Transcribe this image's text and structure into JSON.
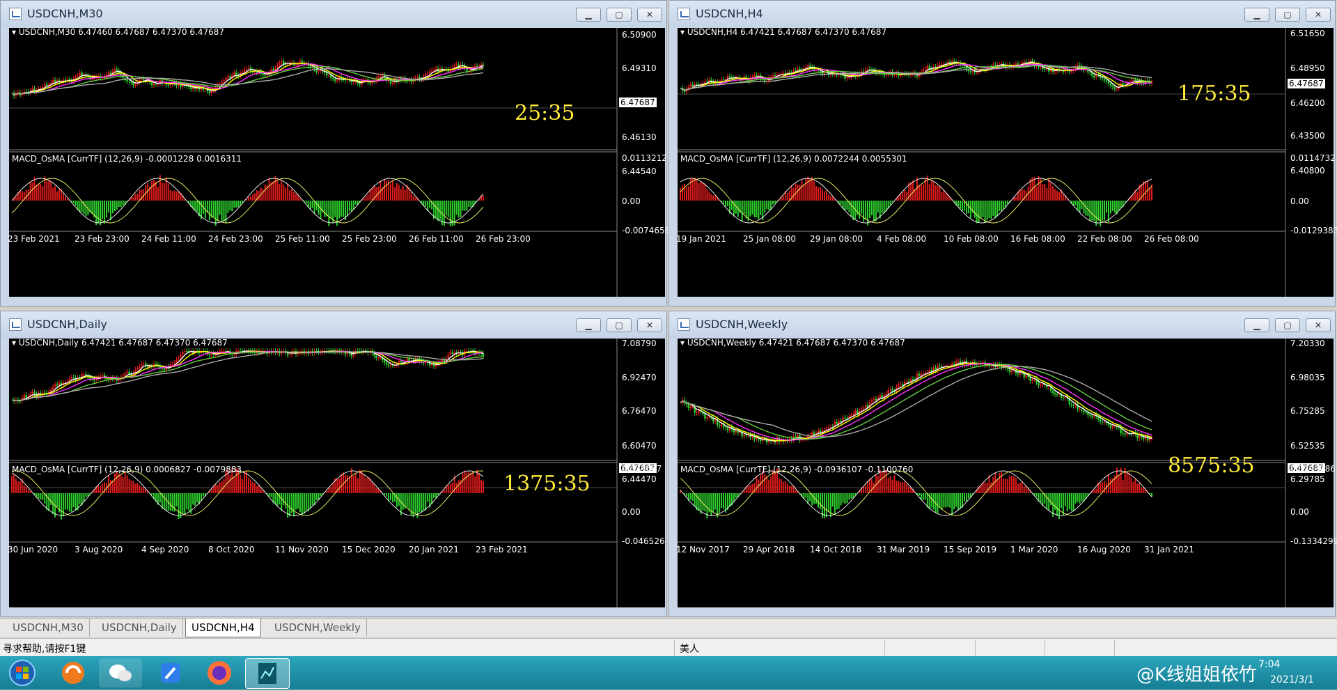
{
  "windows": [
    {
      "title": "USDCNH,M30",
      "header": "USDCNH,M30  6.47460 6.47687 6.47370 6.47687",
      "timer": "25:35",
      "price_box": "6.47687",
      "macd_header": "MACD_OsMA [CurrTF] (12,26,9) -0.0001228 0.0016311",
      "price_axis": [
        "6.50900",
        "6.49310",
        "6.46130",
        "6.44540"
      ],
      "macd_axis": [
        "0.0113212",
        "0.00",
        "-0.0074659"
      ],
      "dates": [
        "23 Feb 2021",
        "23 Feb 23:00",
        "24 Feb 11:00",
        "24 Feb 23:00",
        "25 Feb 11:00",
        "25 Feb 23:00",
        "26 Feb 11:00",
        "26 Feb 23:00"
      ],
      "buttons": {
        "min": "▁",
        "max": "▢",
        "close": "✕"
      }
    },
    {
      "title": "USDCNH,H4",
      "header": "USDCNH,H4  6.47421 6.47687 6.47370 6.47687",
      "timer": "175:35",
      "price_box": "6.47687",
      "macd_header": "MACD_OsMA [CurrTF] (12,26,9) 0.0072244 0.0055301",
      "price_axis": [
        "6.51650",
        "6.48950",
        "6.46200",
        "6.43500",
        "6.40800"
      ],
      "macd_axis": [
        "0.0114732",
        "0.00",
        "-0.0129383"
      ],
      "dates": [
        "19 Jan 2021",
        "25 Jan 08:00",
        "29 Jan 08:00",
        "4 Feb 08:00",
        "10 Feb 08:00",
        "16 Feb 08:00",
        "22 Feb 08:00",
        "26 Feb 08:00"
      ],
      "buttons": {
        "min": "▁",
        "max": "▢",
        "close": "✕"
      }
    },
    {
      "title": "USDCNH,Daily",
      "header": "USDCNH,Daily  6.47421 6.47687 6.47370 6.47687",
      "timer": "1375:35",
      "price_box": "6.47687",
      "macd_header": "MACD_OsMA [CurrTF] (12,26,9) 0.0006827 -0.0079883",
      "price_axis": [
        "7.08790",
        "6.92470",
        "6.76470",
        "6.60470",
        "6.44470"
      ],
      "macd_axis": [
        "0.023687",
        "0.00",
        "-0.046526"
      ],
      "dates": [
        "30 Jun 2020",
        "3 Aug 2020",
        "4 Sep 2020",
        "8 Oct 2020",
        "11 Nov 2020",
        "15 Dec 2020",
        "20 Jan 2021",
        "23 Feb 2021"
      ],
      "buttons": {
        "min": "▁",
        "max": "▢",
        "close": "✕"
      }
    },
    {
      "title": "USDCNH,Weekly",
      "header": "USDCNH,Weekly  6.47421 6.47687 6.47370 6.47687",
      "timer": "8575:35",
      "price_box": "6.47687",
      "macd_header": "MACD_OsMA [CurrTF] (12,26,9) -0.0936107 -0.1100760",
      "price_axis": [
        "7.20330",
        "6.98035",
        "6.75285",
        "6.52535",
        "6.29785"
      ],
      "macd_axis": [
        "0.1343086",
        "0.00",
        "-0.1334299"
      ],
      "dates": [
        "12 Nov 2017",
        "29 Apr 2018",
        "14 Oct 2018",
        "31 Mar 2019",
        "15 Sep 2019",
        "1 Mar 2020",
        "16 Aug 2020",
        "31 Jan 2021"
      ],
      "buttons": {
        "min": "▁",
        "max": "▢",
        "close": "✕"
      }
    }
  ],
  "tabs": [
    "USDCNH,M30",
    "USDCNH,Daily",
    "USDCNH,H4",
    "USDCNH,Weekly"
  ],
  "active_tab": "USDCNH,H4",
  "status": {
    "help": "寻求帮助,请按F1键",
    "profile": "美人"
  },
  "taskbar": {
    "time": "7:04",
    "date": "2021/3/1",
    "watermark": "@K线姐姐依竹"
  },
  "colors": {
    "bull": "#e01b1b",
    "bear": "#2fd12f",
    "ma_fast": "#ffffff",
    "ma_mid": "#ffff00",
    "ma_slow": "#ff33ff",
    "ma_green": "#66cc44",
    "ma_grey": "#aaaaaa",
    "timer": "#ffeb3b"
  },
  "icons": [
    "windows-start-icon",
    "app-orange-icon",
    "wechat-icon",
    "pen-app-icon",
    "firefox-icon",
    "trading-app-icon"
  ]
}
